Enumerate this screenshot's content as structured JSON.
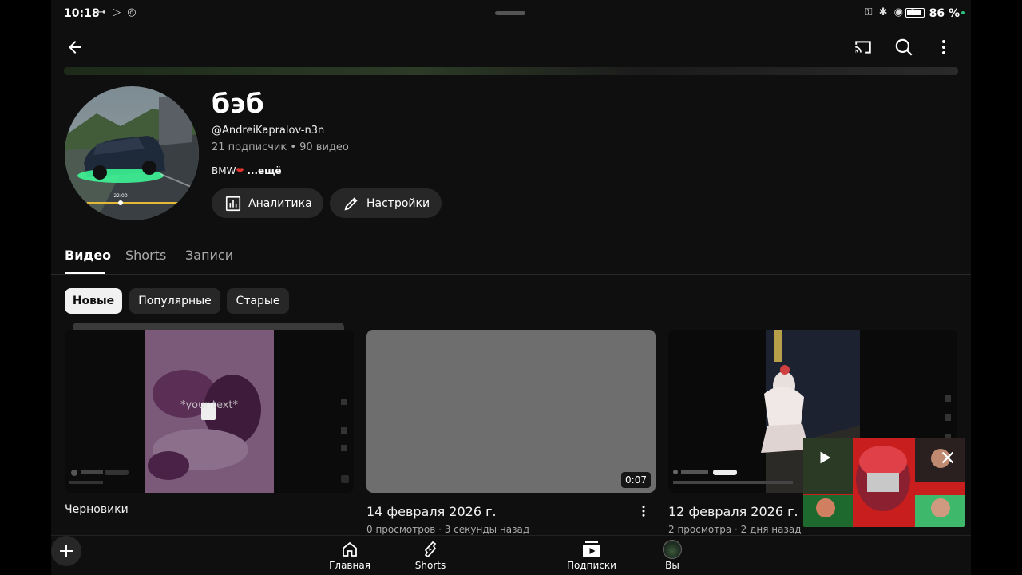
{
  "status_bar": {
    "time": "10:18",
    "battery": "86 %"
  },
  "channel": {
    "name": "бэб",
    "handle": "@AndreiKapralov-n3n",
    "stats": "21 подписчик • 90 видео",
    "description": "BMW",
    "more": "...ещё",
    "avatar_time": "22:00",
    "analytics_label": "Аналитика",
    "settings_label": "Настройки"
  },
  "tabs": [
    {
      "label": "Видео",
      "active": true
    },
    {
      "label": "Shorts",
      "active": false
    },
    {
      "label": "Записи",
      "active": false
    }
  ],
  "filters": [
    {
      "label": "Новые",
      "selected": true
    },
    {
      "label": "Популярные",
      "selected": false
    },
    {
      "label": "Старые",
      "selected": false
    }
  ],
  "videos": [
    {
      "title": "Черновики",
      "meta": "",
      "duration": "",
      "overlay_text": "*your text*"
    },
    {
      "title": "14 февраля 2026 г.",
      "meta": "0 просмотров · 3 секунды назад",
      "duration": "0:07"
    },
    {
      "title": "12 февраля 2026 г.",
      "meta": "2 просмотра · 2 дня назад",
      "duration": ""
    }
  ],
  "bottom_nav": [
    {
      "label": "Главная",
      "icon": "home-icon"
    },
    {
      "label": "Shorts",
      "icon": "shorts-icon"
    },
    {
      "label": "",
      "icon": "plus-icon"
    },
    {
      "label": "Подписки",
      "icon": "subscriptions-icon"
    },
    {
      "label": "Вы",
      "icon": "avatar"
    }
  ],
  "colors": {
    "background": "#0f0f0f",
    "chip": "#272727",
    "selected_chip": "#f1f1f1",
    "secondary_text": "#aaaaaa",
    "accent_green": "#3dff9a"
  }
}
